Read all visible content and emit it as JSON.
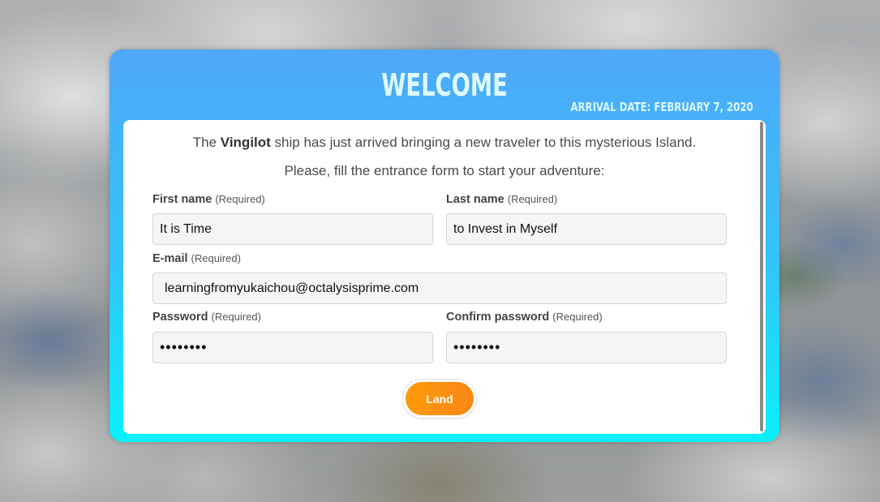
{
  "header": {
    "title": "Welcome",
    "arrival_date": "Arrival date: February 7, 2020"
  },
  "intro": {
    "line1_before": "The ",
    "ship_name": "Vingilot",
    "line1_after": " ship has just arrived bringing a new traveler to this mysterious Island.",
    "line2": "Please, fill the entrance form to start your adventure:"
  },
  "form": {
    "first_name": {
      "label": "First name",
      "required": "(Required)",
      "value": "It is Time"
    },
    "last_name": {
      "label": "Last name",
      "required": "(Required)",
      "value": "to Invest in Myself"
    },
    "email": {
      "label": "E-mail",
      "required": "(Required)",
      "value": "learningfromyukaichou@octalysisprime.com"
    },
    "password": {
      "label": "Password",
      "required": "(Required)",
      "value": "••••••••"
    },
    "confirm_password": {
      "label": "Confirm password",
      "required": "(Required)",
      "value": "••••••••"
    },
    "submit_label": "Land"
  },
  "colors": {
    "panel_top": "#4fa8f8",
    "panel_bottom": "#0af0fb",
    "button": "#ff9a0a"
  }
}
